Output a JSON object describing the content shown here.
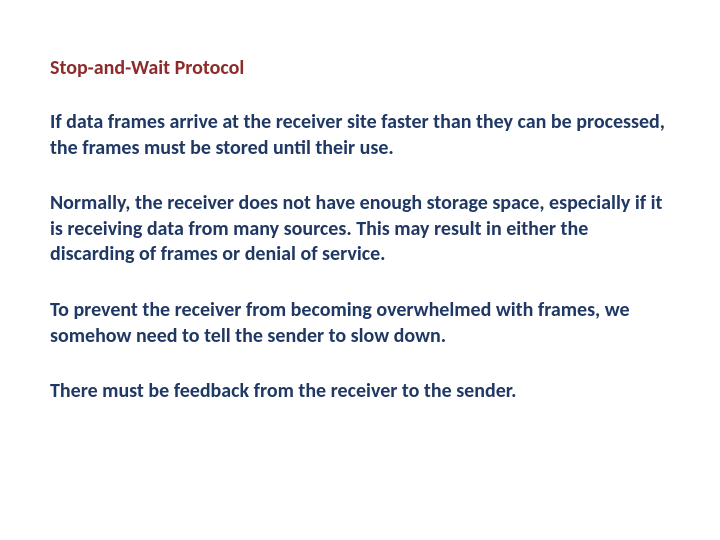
{
  "colors": {
    "title": "#8d2b2b",
    "body": "#1f3864"
  },
  "title": "Stop-and-Wait Protocol",
  "paragraphs": [
    "If data frames arrive at the receiver site faster than they can be processed, the frames must be stored until their use.",
    "Normally, the receiver does not have enough storage space, especially if it is receiving data from many sources. This may result in either the discarding of frames or denial of service.",
    "To prevent the receiver from becoming overwhelmed with frames, we somehow need to tell the sender to slow down.",
    "There must be feedback from the receiver to the sender."
  ]
}
